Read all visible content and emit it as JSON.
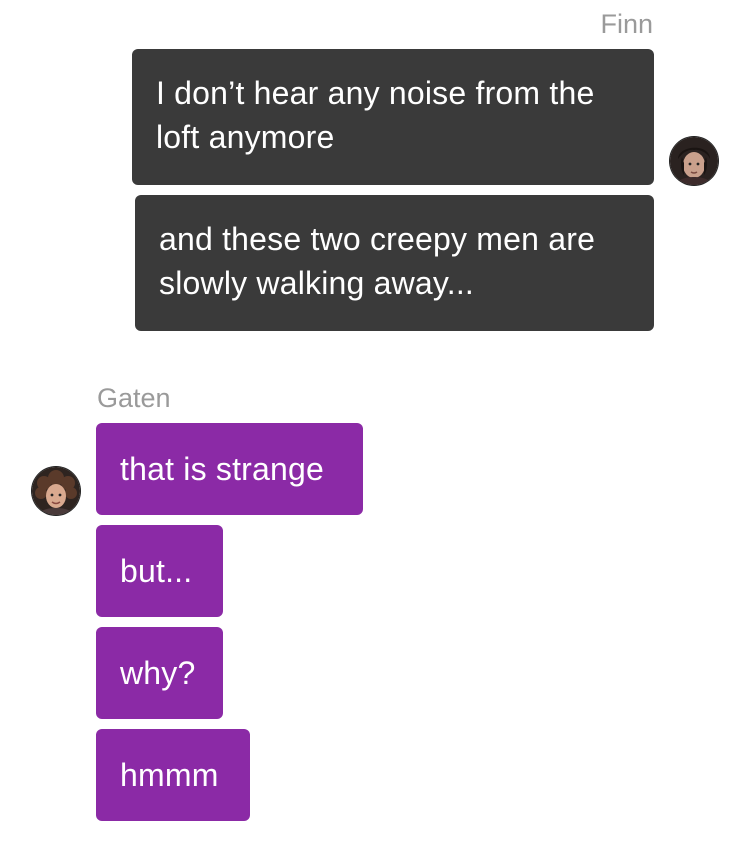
{
  "outgoing": {
    "sender": "Finn",
    "messages": [
      "I don’t hear any noise from the loft anymore",
      "and these two creepy men are slowly walking away..."
    ],
    "bubble_color": "#3a3a3a"
  },
  "incoming": {
    "sender": "Gaten",
    "messages": [
      "that is strange",
      "but...",
      "why?",
      "hmmm"
    ],
    "bubble_color": "#8b2aa6"
  },
  "colors": {
    "background": "#ffffff",
    "name_text": "#9a9a9a",
    "bubble_text": "#ffffff"
  },
  "icons": {
    "finn_avatar": "avatar-portrait",
    "gaten_avatar": "avatar-portrait-curly"
  }
}
